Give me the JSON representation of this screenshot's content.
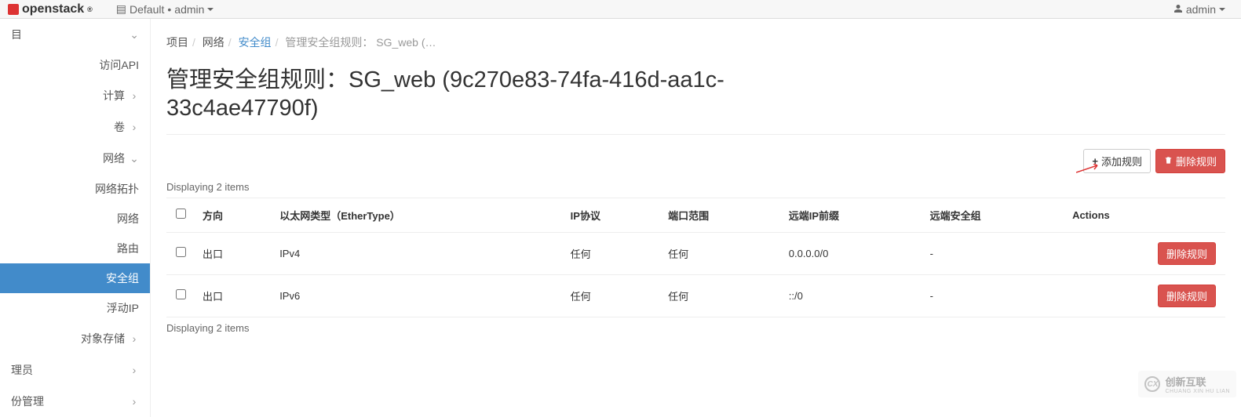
{
  "topbar": {
    "brand": "openstack",
    "context_domain": "Default",
    "context_project": "admin",
    "user": "admin"
  },
  "sidebar": {
    "top_item": "目",
    "items": [
      {
        "label": "访问API",
        "type": "sub"
      },
      {
        "label": "计算",
        "type": "group",
        "chev": "right"
      },
      {
        "label": "卷",
        "type": "group",
        "chev": "right"
      },
      {
        "label": "网络",
        "type": "group",
        "chev": "down"
      },
      {
        "label": "网络拓扑",
        "type": "sub"
      },
      {
        "label": "网络",
        "type": "sub"
      },
      {
        "label": "路由",
        "type": "sub"
      },
      {
        "label": "安全组",
        "type": "sub",
        "active": true
      },
      {
        "label": "浮动IP",
        "type": "sub"
      },
      {
        "label": "对象存储",
        "type": "group",
        "chev": "right"
      },
      {
        "label": "理员",
        "type": "group",
        "chev": "right"
      },
      {
        "label": "份管理",
        "type": "group",
        "chev": "right"
      }
    ]
  },
  "breadcrumb": {
    "l1": "项目",
    "l2": "网络",
    "l3": "安全组",
    "l4": "管理安全组规则： SG_web (…"
  },
  "page": {
    "title": "管理安全组规则：SG_web (9c270e83-74fa-416d-aa1c-33c4ae47790f)",
    "add_rule": "添加规则",
    "delete_rule": "删除规则",
    "display_count": "Displaying 2 items"
  },
  "table": {
    "headers": {
      "direction": "方向",
      "ethertype": "以太网类型（EtherType）",
      "protocol": "IP协议",
      "port_range": "端口范围",
      "remote_ip": "远端IP前缀",
      "remote_sg": "远端安全组",
      "actions": "Actions"
    },
    "rows": [
      {
        "direction": "出口",
        "ethertype": "IPv4",
        "protocol": "任何",
        "port_range": "任何",
        "remote_ip": "0.0.0.0/0",
        "remote_sg": "-",
        "action": "删除规则"
      },
      {
        "direction": "出口",
        "ethertype": "IPv6",
        "protocol": "任何",
        "port_range": "任何",
        "remote_ip": "::/0",
        "remote_sg": "-",
        "action": "删除规则"
      }
    ]
  },
  "watermark": {
    "text": "创新互联",
    "sub": "CHUANG XIN HU LIAN",
    "logo": "CX"
  }
}
